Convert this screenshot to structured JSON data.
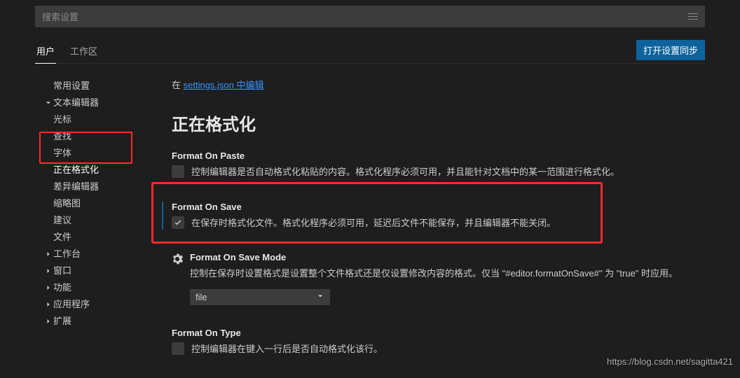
{
  "search": {
    "placeholder": "搜索设置"
  },
  "tabs": {
    "user": "用户",
    "workspace": "工作区"
  },
  "sync_button": "打开设置同步",
  "sidebar": {
    "frequently_used": "常用设置",
    "text_editor": "文本编辑器",
    "cursor": "光标",
    "find": "查找",
    "font": "字体",
    "formatting": "正在格式化",
    "diff_editor": "差异编辑器",
    "minimap": "缩略图",
    "suggestions": "建议",
    "files": "文件",
    "workbench": "工作台",
    "window": "窗口",
    "features": "功能",
    "applications": "应用程序",
    "extensions": "扩展"
  },
  "content": {
    "edit_in_prefix": "在 ",
    "edit_in_link": "settings.json 中编辑",
    "heading": "正在格式化",
    "format_on_paste": {
      "title": "Format On Paste",
      "desc": "控制编辑器是否自动格式化粘贴的内容。格式化程序必须可用，并且能针对文档中的某一范围进行格式化。"
    },
    "format_on_save": {
      "title": "Format On Save",
      "desc": "在保存时格式化文件。格式化程序必须可用，延迟后文件不能保存，并且编辑器不能关闭。"
    },
    "format_on_save_mode": {
      "title": "Format On Save Mode",
      "desc": "控制在保存时设置格式是设置整个文件格式还是仅设置修改内容的格式。仅当 \"#editor.formatOnSave#\" 为 \"true\" 时应用。",
      "value": "file"
    },
    "format_on_type": {
      "title": "Format On Type",
      "desc": "控制编辑器在键入一行后是否自动格式化该行。"
    }
  },
  "watermark": "https://blog.csdn.net/sagitta421"
}
